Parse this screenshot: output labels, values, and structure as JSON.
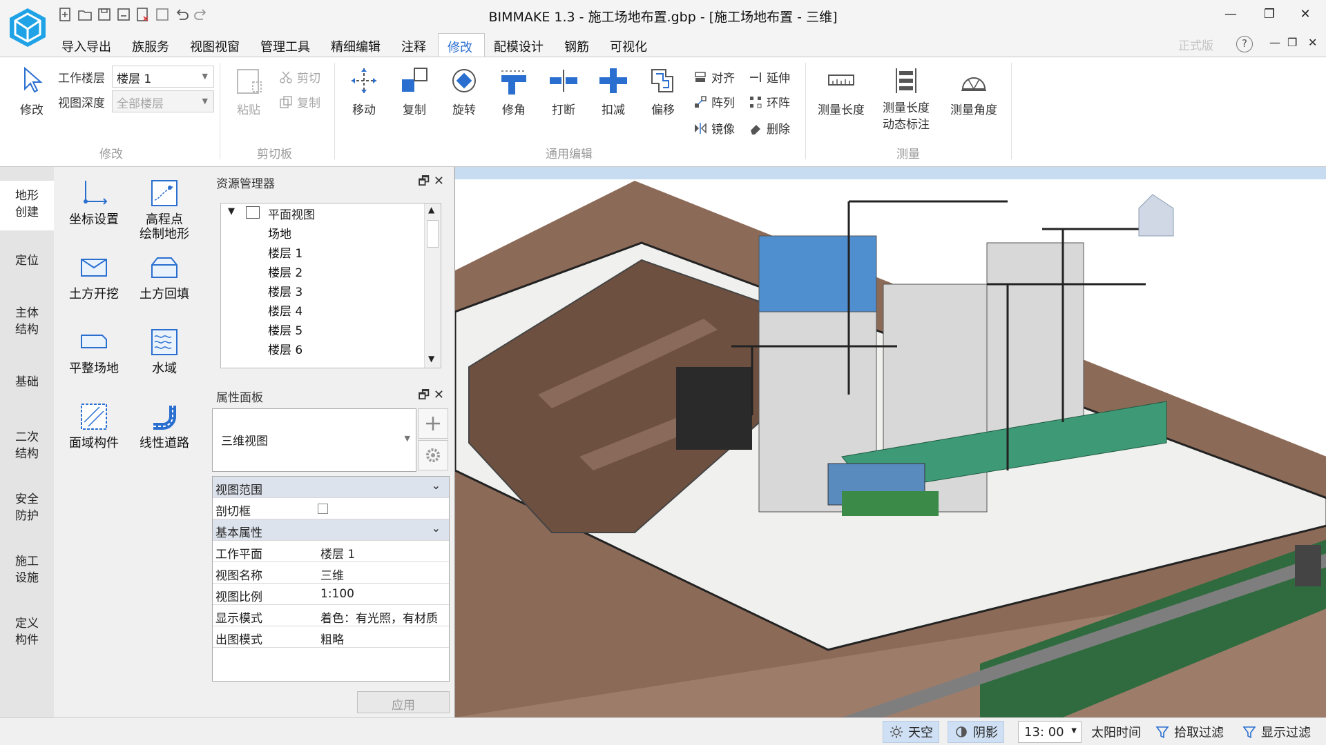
{
  "window": {
    "title": "BIMMAKE 1.3 - 施工场地布置.gbp - [施工场地布置 - 三维]"
  },
  "menu": [
    "导入导出",
    "族服务",
    "视图视窗",
    "管理工具",
    "精细编辑",
    "注释",
    "修改",
    "配模设计",
    "钢筋",
    "可视化"
  ],
  "menu_active": "修改",
  "edition": "正式版",
  "help": "?",
  "ribbon": {
    "modify": {
      "label": "修改",
      "group": "修改",
      "work_level_label": "工作楼层",
      "work_level_value": "楼层 1",
      "view_depth_label": "视图深度",
      "view_depth_value": "全部楼层"
    },
    "clipboard": {
      "group": "剪切板",
      "paste": "粘贴",
      "cut": "剪切",
      "copy": "复制"
    },
    "edit": {
      "group": "通用编辑",
      "move": "移动",
      "copy": "复制",
      "rotate": "旋转",
      "trim": "修角",
      "break": "打断",
      "deduct": "扣减",
      "offset": "偏移",
      "align": "对齐",
      "array": "阵列",
      "mirror": "镜像",
      "extend": "延伸",
      "ring_array": "环阵",
      "delete": "删除"
    },
    "measure": {
      "group": "测量",
      "length": "测量长度",
      "dyn_line1": "测量长度",
      "dyn_line2": "动态标注",
      "angle": "测量角度"
    }
  },
  "left_tabs": [
    {
      "l1": "地形",
      "l2": "创建"
    },
    {
      "l1": "定位",
      "l2": ""
    },
    {
      "l1": "主体",
      "l2": "结构"
    },
    {
      "l1": "基础",
      "l2": ""
    },
    {
      "l1": "二次",
      "l2": "结构"
    },
    {
      "l1": "安全",
      "l2": "防护"
    },
    {
      "l1": "施工",
      "l2": "设施"
    },
    {
      "l1": "定义",
      "l2": "构件"
    }
  ],
  "tools": [
    {
      "l1": "坐标设置",
      "l2": ""
    },
    {
      "l1": "高程点",
      "l2": "绘制地形"
    },
    {
      "l1": "土方开挖",
      "l2": ""
    },
    {
      "l1": "土方回填",
      "l2": ""
    },
    {
      "l1": "平整场地",
      "l2": ""
    },
    {
      "l1": "水域",
      "l2": ""
    },
    {
      "l1": "面域构件",
      "l2": ""
    },
    {
      "l1": "线性道路",
      "l2": ""
    }
  ],
  "resource_manager": {
    "title": "资源管理器",
    "root": "平面视图",
    "items": [
      "场地",
      "楼层 1",
      "楼层 2",
      "楼层 3",
      "楼层 4",
      "楼层 5",
      "楼层 6"
    ]
  },
  "properties": {
    "title": "属性面板",
    "view_type": "三维视图",
    "sections": [
      {
        "name": "视图范围",
        "rows": [
          {
            "k": "剖切框",
            "v": ""
          }
        ]
      },
      {
        "name": "基本属性",
        "rows": [
          {
            "k": "工作平面",
            "v": "楼层 1"
          },
          {
            "k": "视图名称",
            "v": "三维"
          },
          {
            "k": "视图比例",
            "v": "1:100"
          },
          {
            "k": "显示模式",
            "v": "着色：有光照，有材质"
          },
          {
            "k": "出图模式",
            "v": "粗略"
          }
        ]
      }
    ],
    "apply": "应用"
  },
  "status": {
    "sky": "天空",
    "shadow": "阴影",
    "time": "13: 00",
    "sun_time": "太阳时间",
    "pick_filter": "拾取过滤",
    "display_filter": "显示过滤"
  },
  "colors": {
    "accent": "#2a6fd0",
    "logo": "#1fa3e6",
    "ground": "#8c6a58",
    "grass": "#2f6b3e"
  }
}
